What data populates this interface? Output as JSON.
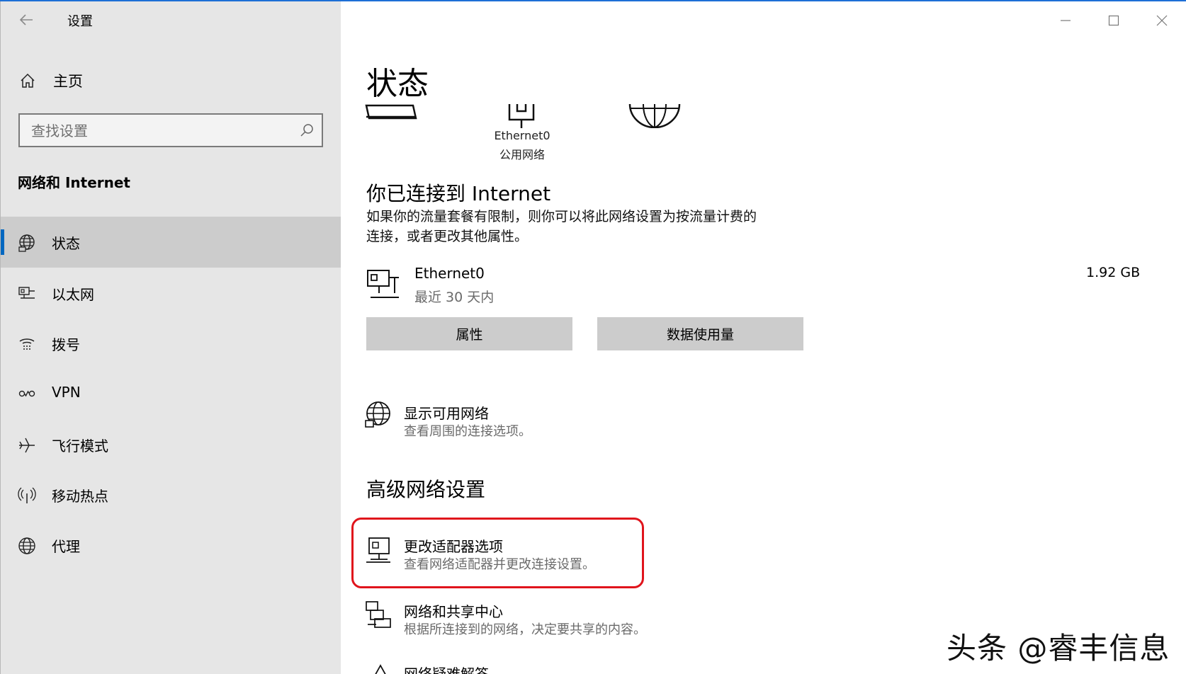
{
  "window": {
    "title": "设置"
  },
  "sidebar": {
    "home_label": "主页",
    "search_placeholder": "查找设置",
    "section_title": "网络和 Internet",
    "items": [
      {
        "label": "状态",
        "icon": "globe-status-icon",
        "active": true
      },
      {
        "label": "以太网",
        "icon": "ethernet-icon"
      },
      {
        "label": "拨号",
        "icon": "dialup-icon"
      },
      {
        "label": "VPN",
        "icon": "vpn-icon"
      },
      {
        "label": "飞行模式",
        "icon": "airplane-icon"
      },
      {
        "label": "移动热点",
        "icon": "hotspot-icon"
      },
      {
        "label": "代理",
        "icon": "proxy-globe-icon"
      }
    ]
  },
  "main": {
    "title": "状态",
    "diagram": {
      "adapter_name": "Ethernet0",
      "network_type": "公用网络"
    },
    "connected_heading": "你已连接到 Internet",
    "connected_desc_line1": "如果你的流量套餐有限制，则你可以将此网络设置为按流量计费的",
    "connected_desc_line2": "连接，或者更改其他属性。",
    "adapter": {
      "name": "Ethernet0",
      "period": "最近 30 天内",
      "usage": "1.92 GB"
    },
    "buttons": {
      "properties": "属性",
      "data_usage": "数据使用量"
    },
    "show_networks": {
      "title": "显示可用网络",
      "subtitle": "查看周围的连接选项。"
    },
    "advanced_heading": "高级网络设置",
    "advanced": [
      {
        "title": "更改适配器选项",
        "subtitle": "查看网络适配器并更改连接设置。"
      },
      {
        "title": "网络和共享中心",
        "subtitle": "根据所连接到的网络，决定要共享的内容。"
      },
      {
        "title": "网络疑难解答"
      }
    ]
  },
  "watermark": "头条 @睿丰信息",
  "colors": {
    "accent": "#0067c0",
    "highlight": "#e0141c",
    "sidebar_bg": "#e6e6e6"
  }
}
